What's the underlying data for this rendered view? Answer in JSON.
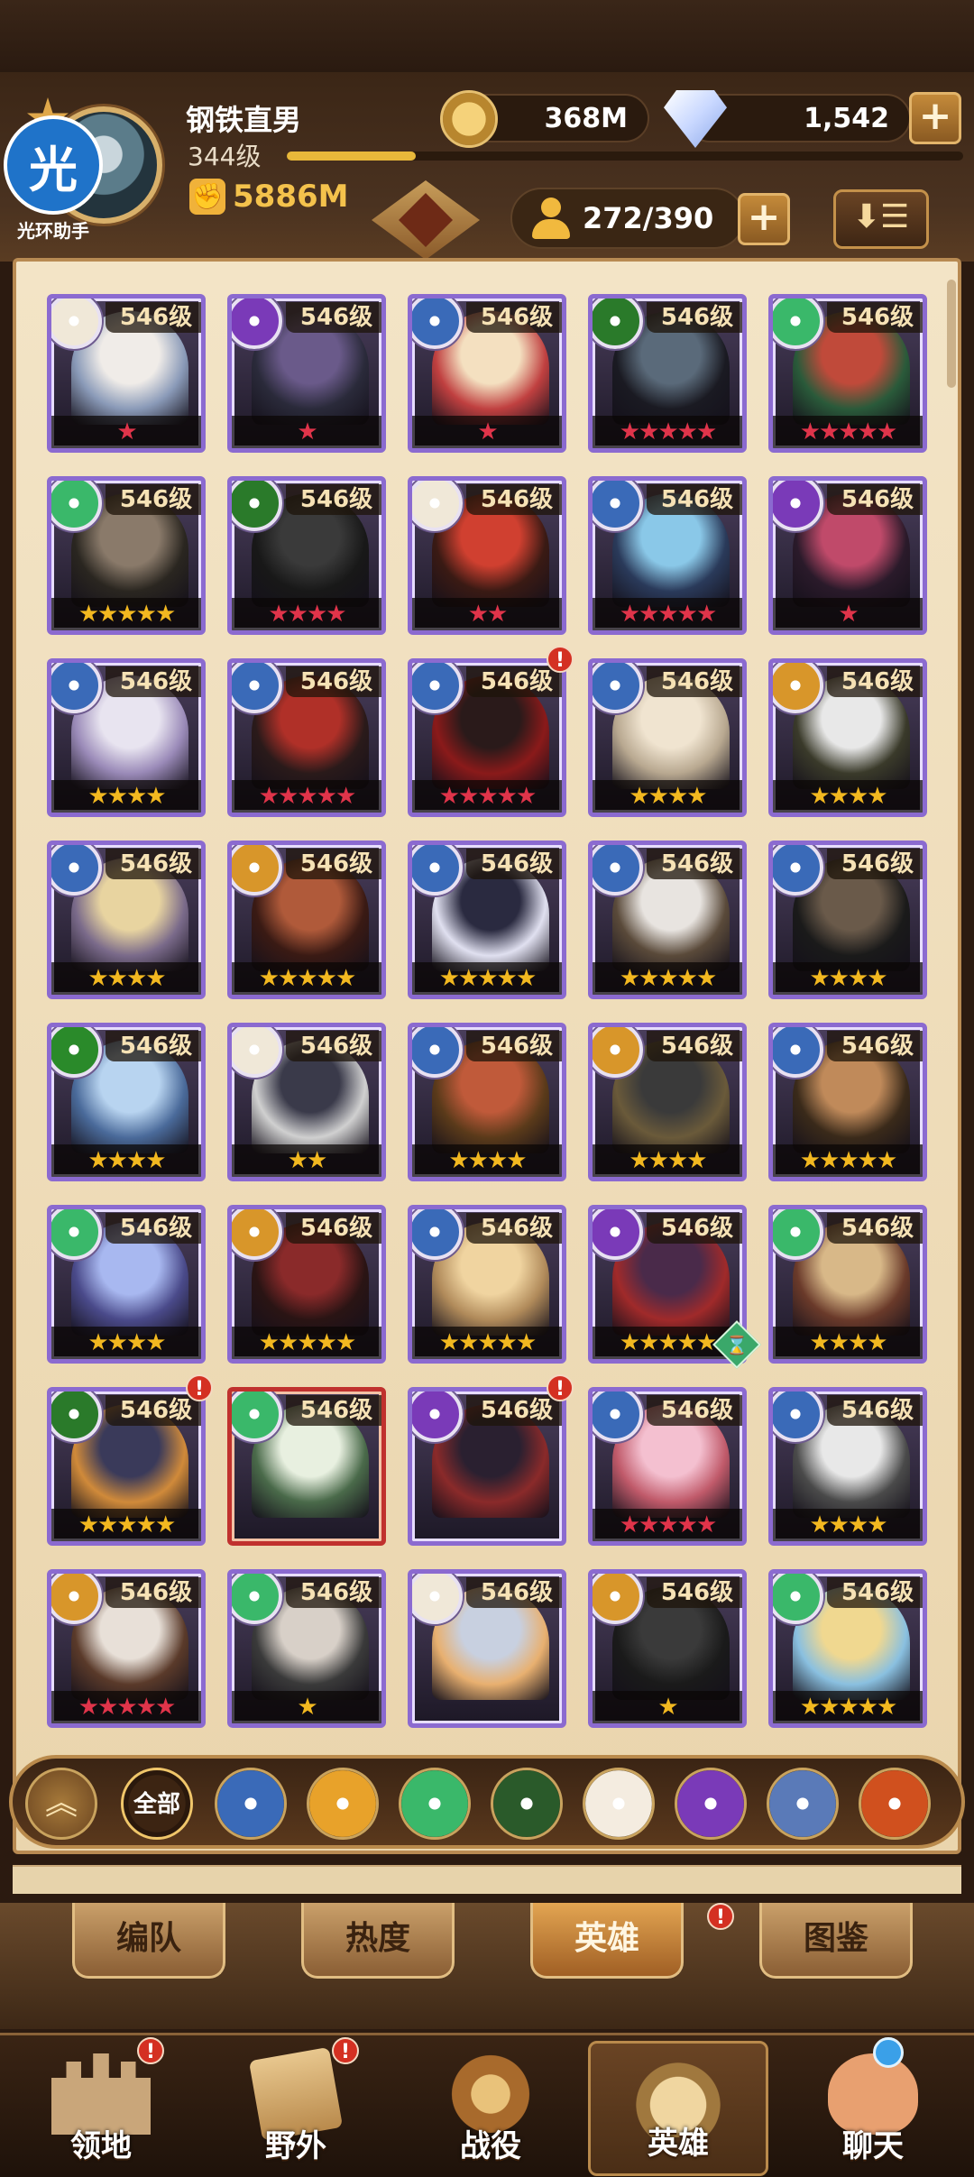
{
  "player": {
    "name": "钢铁直男",
    "level": "344级",
    "xp_fraction": 0.19,
    "power": "5886M"
  },
  "assistant_badge": {
    "glyph": "光",
    "label": "光环助手"
  },
  "currencies": {
    "gold": "368M",
    "gems": "1,542"
  },
  "hero_count": "272/390",
  "buttons": {
    "plus": "+",
    "sort": "⬇☰"
  },
  "heroes": [
    {
      "level": "546级",
      "faction": "celestial",
      "stars": "★",
      "star_color": "red",
      "portrait": [
        "#f0ece8",
        "#8a9ab8"
      ]
    },
    {
      "level": "546级",
      "faction": "hypogean",
      "stars": "★",
      "star_color": "red",
      "portrait": [
        "#6a5a8a",
        "#2a2a3a"
      ]
    },
    {
      "level": "546级",
      "faction": "lightbearer",
      "stars": "★",
      "star_color": "red",
      "portrait": [
        "#f4e0c0",
        "#c04040"
      ]
    },
    {
      "level": "546级",
      "faction": "graveborn",
      "stars": "★★★★★",
      "star_color": "red",
      "portrait": [
        "#5a6a7a",
        "#1a1a22"
      ]
    },
    {
      "level": "546级",
      "faction": "wilder",
      "stars": "★★★★★",
      "star_color": "red",
      "portrait": [
        "#c04a3a",
        "#2a5a3a"
      ]
    },
    {
      "level": "546级",
      "faction": "wilder",
      "stars": "★★★★★",
      "star_color": "gold",
      "portrait": [
        "#8a7a6a",
        "#2a2620"
      ]
    },
    {
      "level": "546级",
      "faction": "graveborn",
      "stars": "★★★★",
      "star_color": "red",
      "portrait": [
        "#3a3a3a",
        "#181818"
      ]
    },
    {
      "level": "546级",
      "faction": "celestial",
      "stars": "★★",
      "star_color": "red",
      "portrait": [
        "#d04030",
        "#3a1a14"
      ]
    },
    {
      "level": "546级",
      "faction": "lightbearer",
      "stars": "★★★★★",
      "star_color": "red",
      "portrait": [
        "#8ac8e8",
        "#2a3a5a"
      ]
    },
    {
      "level": "546级",
      "faction": "hypogean",
      "stars": "★",
      "star_color": "red",
      "portrait": [
        "#c04a6a",
        "#2a1a2a"
      ]
    },
    {
      "level": "546级",
      "faction": "lightbearer",
      "stars": "★★★★",
      "star_color": "gold",
      "portrait": [
        "#e8e4f0",
        "#9a8ab8"
      ]
    },
    {
      "level": "546级",
      "faction": "lightbearer",
      "stars": "★★★★★",
      "star_color": "red",
      "portrait": [
        "#b03028",
        "#2a1a1a"
      ]
    },
    {
      "level": "546级",
      "faction": "lightbearer",
      "stars": "★★★★★",
      "star_color": "red",
      "portrait": [
        "#2a1a1a",
        "#8a1a1a"
      ],
      "notify": true
    },
    {
      "level": "546级",
      "faction": "lightbearer",
      "stars": "★★★★",
      "star_color": "gold",
      "portrait": [
        "#f0e4d0",
        "#b8a890"
      ]
    },
    {
      "level": "546级",
      "faction": "mauler",
      "stars": "★★★★",
      "star_color": "gold",
      "portrait": [
        "#e8e8e8",
        "#3a3a2a"
      ]
    },
    {
      "level": "546级",
      "faction": "lightbearer",
      "stars": "★★★★",
      "star_color": "gold",
      "portrait": [
        "#e8d4a0",
        "#7a6a8a"
      ]
    },
    {
      "level": "546级",
      "faction": "mauler",
      "stars": "★★★★★",
      "star_color": "gold",
      "portrait": [
        "#b05a3a",
        "#3a1a14"
      ]
    },
    {
      "level": "546级",
      "faction": "lightbearer",
      "stars": "★★★★★",
      "star_color": "gold",
      "portrait": [
        "#2a2a40",
        "#e0e0f0"
      ]
    },
    {
      "level": "546级",
      "faction": "lightbearer",
      "stars": "★★★★★",
      "star_color": "gold",
      "portrait": [
        "#e8e4e0",
        "#5a4a3a"
      ]
    },
    {
      "level": "546级",
      "faction": "lightbearer",
      "stars": "★★★★",
      "star_color": "gold",
      "portrait": [
        "#6a5a4a",
        "#1a1a1a"
      ]
    },
    {
      "level": "546级",
      "faction": "wilder_green",
      "stars": "★★★★",
      "star_color": "gold",
      "portrait": [
        "#b8d4f0",
        "#4a6a9a"
      ]
    },
    {
      "level": "546级",
      "faction": "celestial",
      "stars": "★★",
      "star_color": "gold",
      "portrait": [
        "#3a3a4a",
        "#d0d0d0"
      ]
    },
    {
      "level": "546级",
      "faction": "lightbearer",
      "stars": "★★★★",
      "star_color": "gold",
      "portrait": [
        "#c05a3a",
        "#5a3a1a"
      ]
    },
    {
      "level": "546级",
      "faction": "mauler",
      "stars": "★★★★",
      "star_color": "gold",
      "portrait": [
        "#3a3a3a",
        "#6a5a3a"
      ]
    },
    {
      "level": "546级",
      "faction": "lightbearer",
      "stars": "★★★★★",
      "star_color": "gold",
      "portrait": [
        "#c08a5a",
        "#3a2a1a"
      ]
    },
    {
      "level": "546级",
      "faction": "wilder",
      "stars": "★★★★",
      "star_color": "gold",
      "portrait": [
        "#a8b8f0",
        "#4a4a8a"
      ]
    },
    {
      "level": "546级",
      "faction": "mauler",
      "stars": "★★★★★",
      "star_color": "gold",
      "portrait": [
        "#8a2a2a",
        "#2a1414"
      ]
    },
    {
      "level": "546级",
      "faction": "lightbearer",
      "stars": "★★★★★",
      "star_color": "gold",
      "portrait": [
        "#f0d4a0",
        "#b08a5a"
      ]
    },
    {
      "level": "546级",
      "faction": "hypogean",
      "stars": "★★★★★",
      "star_color": "gold",
      "portrait": [
        "#4a2a4a",
        "#a02a2a"
      ],
      "hourglass": true
    },
    {
      "level": "546级",
      "faction": "wilder",
      "stars": "★★★★",
      "star_color": "gold",
      "portrait": [
        "#d8b888",
        "#6a3a2a"
      ]
    },
    {
      "level": "546级",
      "faction": "graveborn",
      "stars": "★★★★★",
      "star_color": "gold",
      "portrait": [
        "#3a3a5a",
        "#d08a3a"
      ],
      "notify": true
    },
    {
      "level": "546级",
      "faction": "wilder",
      "stars": "",
      "star_color": "gold",
      "portrait": [
        "#e8f0e0",
        "#4a6a4a"
      ],
      "red_frame": true
    },
    {
      "level": "546级",
      "faction": "hypogean",
      "stars": "",
      "star_color": "gold",
      "portrait": [
        "#2a2030",
        "#8a2a2a"
      ],
      "notify": true
    },
    {
      "level": "546级",
      "faction": "lightbearer",
      "stars": "★★★★★",
      "star_color": "red",
      "portrait": [
        "#f4c0d0",
        "#c05a6a"
      ]
    },
    {
      "level": "546级",
      "faction": "lightbearer",
      "stars": "★★★★",
      "star_color": "gold",
      "portrait": [
        "#e8e8e8",
        "#4a4a4a"
      ]
    },
    {
      "level": "546级",
      "faction": "mauler",
      "stars": "★★★★★",
      "star_color": "red",
      "portrait": [
        "#e8e0d8",
        "#5a3a2a"
      ]
    },
    {
      "level": "546级",
      "faction": "wilder",
      "stars": "★",
      "star_color": "gold",
      "portrait": [
        "#d8d0c8",
        "#3a3a3a"
      ]
    },
    {
      "level": "546级",
      "faction": "celestial",
      "stars": "",
      "star_color": "gold",
      "portrait": [
        "#c8d0e0",
        "#e8b070"
      ]
    },
    {
      "level": "546级",
      "faction": "mauler",
      "stars": "★",
      "star_color": "gold",
      "portrait": [
        "#3a3a3a",
        "#1a1a1a"
      ]
    },
    {
      "level": "546级",
      "faction": "wilder",
      "stars": "★★★★★",
      "star_color": "gold",
      "portrait": [
        "#f0d890",
        "#8ac0e0"
      ]
    }
  ],
  "faction_colors": {
    "celestial": "#f0e8d8",
    "hypogean": "#7a3ab8",
    "lightbearer": "#3a6ab8",
    "graveborn": "#2a7a2a",
    "wilder": "#3ab86a",
    "wilder_green": "#2a8a2a",
    "mauler": "#d8962a"
  },
  "filters": {
    "up": "︽",
    "all": "全部",
    "items": [
      {
        "name": "lightbearer",
        "color": "#3a6ab8"
      },
      {
        "name": "mauler",
        "color": "#e8a22a"
      },
      {
        "name": "wilder",
        "color": "#3ab86a"
      },
      {
        "name": "graveborn",
        "color": "#2a5a2a"
      },
      {
        "name": "celestial",
        "color": "#f4ece0"
      },
      {
        "name": "hypogean",
        "color": "#7a3ab8"
      },
      {
        "name": "dimensional",
        "color": "#5a7ab8"
      },
      {
        "name": "fire",
        "color": "#d0501e"
      }
    ]
  },
  "subtabs": [
    {
      "label": "编队"
    },
    {
      "label": "热度"
    },
    {
      "label": "英雄",
      "active": true,
      "notify": true
    },
    {
      "label": "图鉴"
    }
  ],
  "nav": [
    {
      "label": "领地",
      "notify": true
    },
    {
      "label": "野外",
      "notify": true
    },
    {
      "label": "战役"
    },
    {
      "label": "英雄",
      "active": true
    },
    {
      "label": "聊天",
      "dot": true
    }
  ],
  "notify_glyph": "!",
  "hourglass_glyph": "⌛"
}
